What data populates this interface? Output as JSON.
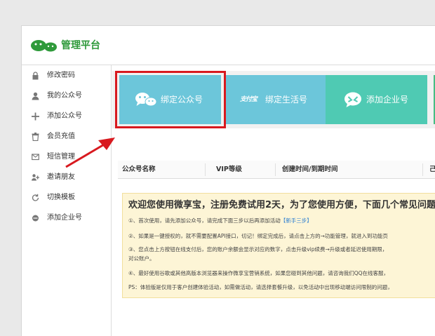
{
  "header": {
    "title": "管理平台"
  },
  "sidebar": {
    "items": [
      {
        "label": "修改密码",
        "icon": "lock-icon"
      },
      {
        "label": "我的公众号",
        "icon": "user-icon"
      },
      {
        "label": "添加公众号",
        "icon": "plus-icon"
      },
      {
        "label": "会员充值",
        "icon": "trash-icon"
      },
      {
        "label": "短信管理",
        "icon": "message-icon"
      },
      {
        "label": "邀请朋友",
        "icon": "invite-icon"
      },
      {
        "label": "切换模板",
        "icon": "refresh-icon"
      },
      {
        "label": "添加企业号",
        "icon": "chat-icon"
      }
    ]
  },
  "tabs": [
    {
      "label": "绑定公众号",
      "icon": "wechat-icon"
    },
    {
      "label": "绑定生活号",
      "icon": "alipay-life-icon",
      "icon_text": "支付宝"
    },
    {
      "label": "添加企业号",
      "icon": "enterprise-icon"
    }
  ],
  "table": {
    "columns": [
      "公众号名称",
      "VIP等级",
      "创建时间/到期时间",
      "己"
    ]
  },
  "notice": {
    "title": "欢迎您使用微享宝，注册免费试用2天，为了您使用方便，下面几个常见问题",
    "lines": [
      "①、首次使用，请先添加公众号，请完成下面三步以后再添加活动",
      "【新手三步】",
      "②、如果是一键授权的，就不需要配置API接口，切记！绑定完成后，请点击上方的→功能管理，就进入到功能页",
      "③、您点击上方按钮在线支付后，您的账户余额会显示对应的数字，点击升级vip续费→升级或者延迟使用期限，",
      "对公账户。",
      "④、最好使用谷歌或其他高版本浏览器来操作微享宝营销系统，如果您碰到其他问题，请咨询我们QQ在线客服，",
      "PS：体验版是仅用于客户创建体验活动，如需做活动，请选择套餐升级，以免活动中出现移动端访问限制的问题，"
    ]
  },
  "colors": {
    "brand_green": "#2f9a3b",
    "tab_blue": "#6cc6da",
    "tab_teal": "#4fcab3",
    "highlight_red": "#d8191f",
    "notice_bg": "#fdf5d6"
  }
}
